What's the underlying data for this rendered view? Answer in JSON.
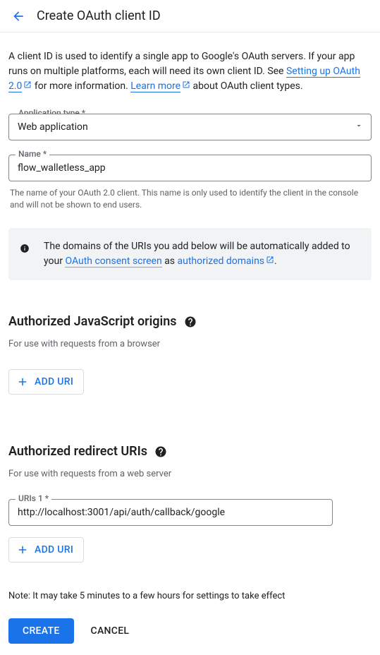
{
  "header": {
    "title": "Create OAuth client ID"
  },
  "intro": {
    "text1": "A client ID is used to identify a single app to Google's OAuth servers. If your app runs on multiple platforms, each will need its own client ID. See ",
    "link1": "Setting up OAuth 2.0",
    "text2": " for more information. ",
    "link2": "Learn more",
    "text3": " about OAuth client types."
  },
  "fields": {
    "app_type_label": "Application type *",
    "app_type_value": "Web application",
    "name_label": "Name *",
    "name_value": "flow_walletless_app",
    "name_helper": "The name of your OAuth 2.0 client. This name is only used to identify the client in the console and will not be shown to end users."
  },
  "info": {
    "text1": "The domains of the URIs you add below will be automatically added to your ",
    "link1": "OAuth consent screen",
    "text2": " as ",
    "link2": "authorized domains",
    "text3": "."
  },
  "js_origins": {
    "title": "Authorized JavaScript origins",
    "desc": "For use with requests from a browser",
    "add_btn": "ADD URI"
  },
  "redirect_uris": {
    "title": "Authorized redirect URIs",
    "desc": "For use with requests from a web server",
    "uri1_label": "URIs 1 *",
    "uri1_value": "http://localhost:3001/api/auth/callback/google",
    "add_btn": "ADD URI"
  },
  "note": "Note: It may take 5 minutes to a few hours for settings to take effect",
  "actions": {
    "create": "CREATE",
    "cancel": "CANCEL"
  }
}
